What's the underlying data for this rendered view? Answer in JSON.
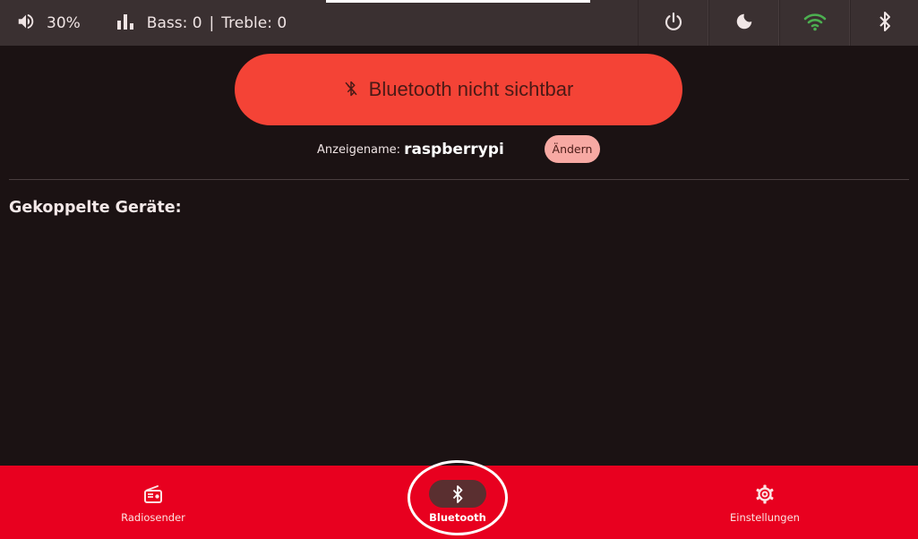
{
  "status": {
    "volume": "30%",
    "bass_label": "Bass: 0",
    "separator": "|",
    "treble_label": "Treble: 0"
  },
  "top_icons": [
    "power-icon",
    "moon-icon",
    "wifi-icon",
    "bluetooth-icon"
  ],
  "colors": {
    "top_bar": "#3a3031",
    "background": "#1b1213",
    "toggle": "#f44336",
    "change_button": "#f7a9a3",
    "bottom_nav": "#e8001f",
    "wifi": "#4caf50"
  },
  "bluetooth": {
    "toggle_label": "Bluetooth nicht sichtbar",
    "display_name_label": "Anzeigename:",
    "display_name": "raspberrypi",
    "change_label": "Ändern",
    "paired_title": "Gekoppelte Geräte:"
  },
  "nav": {
    "radio": "Radiosender",
    "bluetooth": "Bluetooth",
    "settings": "Einstellungen"
  }
}
